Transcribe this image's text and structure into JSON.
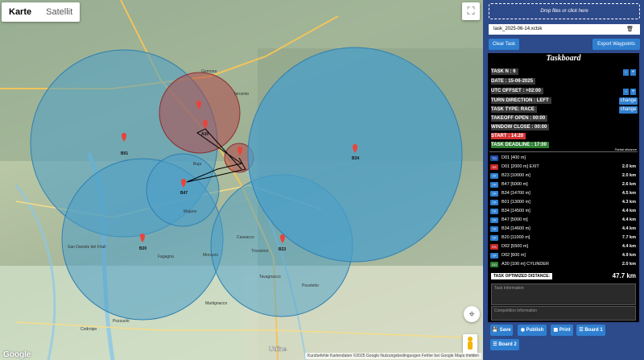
{
  "map": {
    "type_tabs": [
      "Karte",
      "Satellit"
    ],
    "active_tab": "Karte",
    "fullscreen_icon": "fullscreen-icon",
    "locate_icon": "locate-icon",
    "zoom_in": "+",
    "zoom_out": "−",
    "google_logo": "Google",
    "attribution": "Kurzbefehle   Kartendaten ©2025 Google   Nutzungsbedingungen   Fehler bei Google Maps melden",
    "waypoints": [
      "B01",
      "A30",
      "B34",
      "B47",
      "B20",
      "B23"
    ],
    "towns": [
      "Udine",
      "Cassacco",
      "Tricesimo",
      "Tarcento",
      "Gemona",
      "Buja",
      "Majano",
      "Fagagna",
      "San Daniele del Friuli",
      "Codroipo",
      "Pozzuolo",
      "Martignacco",
      "Moruzzo",
      "Tavagnacco",
      "Povoletto"
    ],
    "circle_colors": {
      "blue": "#4a9fc9",
      "red": "#b0474a"
    }
  },
  "panel": {
    "drop_label": "Drop files or click here",
    "file_name": "task_2025-06-14.xctsk",
    "trash_icon": "trash-icon",
    "clear_button": "Clear Task",
    "export_button": "Export Waypoints"
  },
  "taskboard": {
    "title": "Taskboard",
    "task_n": "TASK N : 6",
    "date": "DATE : 15-06-2025",
    "utc_offset": "UTC OFFSET : +02:00",
    "turn_direction": "TURN DIRECTION : LEFT",
    "task_type": "TASK TYPE: RACE",
    "takeoff_open": "TAKEOFF OPEN : 00:00",
    "window_close": "WINDOW CLOSE : 00:00",
    "start": "START : 14:20",
    "task_deadline": "TASK DEADLINE : 17:00",
    "change_label": "change",
    "minus": "-",
    "plus": "+",
    "partial_distance": "Partial distance",
    "waypoints": [
      {
        "badge": "TO",
        "name": "D01 [400 m]",
        "dist": "",
        "color": "#1e4fa8"
      },
      {
        "badge": "SS",
        "name": "D01 [2000 m] EXIT",
        "dist": "2.0 km",
        "color": "#c62828"
      },
      {
        "badge": "TP",
        "name": "B23 [10000 m]",
        "dist": "2.0 km",
        "color": "#2f7fd0"
      },
      {
        "badge": "TP",
        "name": "B47 [5000 m]",
        "dist": "2.6 km",
        "color": "#2f7fd0"
      },
      {
        "badge": "TP",
        "name": "B34 [14700 m]",
        "dist": "4.5 km",
        "color": "#2f7fd0"
      },
      {
        "badge": "TP",
        "name": "B01 [13000 m]",
        "dist": "4.3 km",
        "color": "#2f7fd0"
      },
      {
        "badge": "TP",
        "name": "B34 [14500 m]",
        "dist": "4.4 km",
        "color": "#2f7fd0"
      },
      {
        "badge": "TP",
        "name": "B47 [5000 m]",
        "dist": "4.4 km",
        "color": "#2f7fd0"
      },
      {
        "badge": "TP",
        "name": "B34 [14600 m]",
        "dist": "4.4 km",
        "color": "#2f7fd0"
      },
      {
        "badge": "TP",
        "name": "B20 [11000 m]",
        "dist": "7.7 km",
        "color": "#2f7fd0"
      },
      {
        "badge": "ES",
        "name": "D02 [5500 m]",
        "dist": "4.4 km",
        "color": "#c62828"
      },
      {
        "badge": "TP",
        "name": "D02 [600 m]",
        "dist": "4.9 km",
        "color": "#2f7fd0"
      },
      {
        "badge": "GO",
        "name": "A30 [100 m] CYLINDER",
        "dist": "2.0 km",
        "color": "#2e7d32"
      }
    ],
    "optimized_label": "TASK OPTIMIZED DISTANCE:",
    "optimized_value": "47.7 km",
    "task_info_placeholder": "Task Information",
    "competition_info_placeholder": "Competition Information"
  },
  "bottom_buttons": {
    "save": "Save",
    "publish": "Publish",
    "print": "Print",
    "board1": "Board 1",
    "board2": "Board 2"
  }
}
